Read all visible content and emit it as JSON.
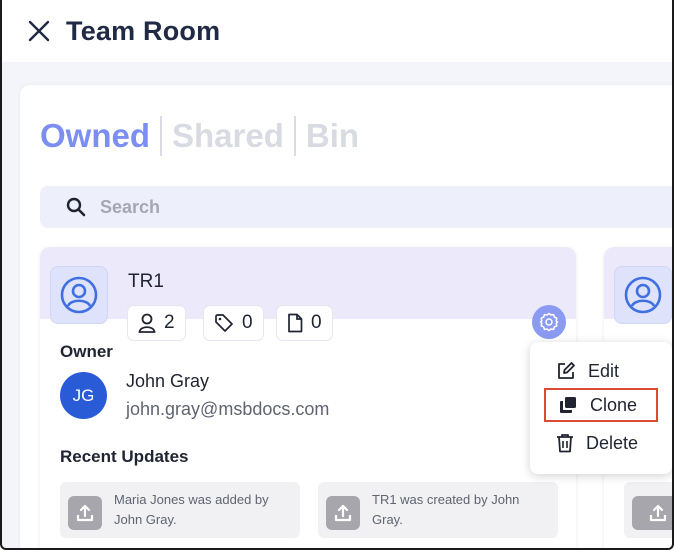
{
  "header": {
    "title": "Team Room"
  },
  "tabs": [
    {
      "label": "Owned",
      "active": true
    },
    {
      "label": "Shared",
      "active": false
    },
    {
      "label": "Bin",
      "active": false
    }
  ],
  "search": {
    "placeholder": "Search"
  },
  "card": {
    "name": "TR1",
    "stats": {
      "members": "2",
      "tags": "0",
      "files": "0"
    },
    "owner_label": "Owner",
    "owner": {
      "initials": "JG",
      "name": "John Gray",
      "email": "john.gray@msbdocs.com"
    },
    "recent_label": "Recent Updates",
    "updates": [
      {
        "text": "Maria Jones was added by John Gray."
      },
      {
        "text": "TR1 was created by John Gray."
      }
    ]
  },
  "menu": {
    "items": [
      {
        "label": "Edit",
        "icon": "edit-icon"
      },
      {
        "label": "Clone",
        "icon": "clone-icon",
        "highlighted": true
      },
      {
        "label": "Delete",
        "icon": "trash-icon"
      }
    ]
  },
  "colors": {
    "accent": "#7c8ff1",
    "tab_inactive": "#d9dbe2",
    "card_header": "#ece9fb",
    "avatar": "#2a5bd7",
    "highlight": "#d94a33"
  }
}
